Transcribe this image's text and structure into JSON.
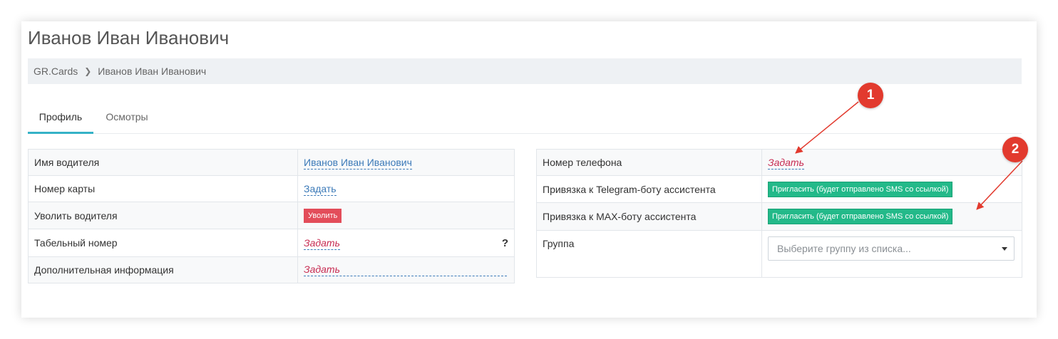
{
  "header": {
    "title": "Иванов Иван Иванович"
  },
  "breadcrumb": {
    "root": "GR.Cards",
    "current": "Иванов Иван Иванович"
  },
  "tabs": [
    {
      "label": "Профиль",
      "active": true
    },
    {
      "label": "Осмотры",
      "active": false
    }
  ],
  "left_table": {
    "driver_name": {
      "label": "Имя водителя",
      "value": "Иванов Иван Иванович"
    },
    "card_number": {
      "label": "Номер карты",
      "value": "Задать"
    },
    "dismiss": {
      "label": "Уволить водителя",
      "button": "Уволить"
    },
    "personnel_number": {
      "label": "Табельный номер",
      "value": "Задать",
      "help": "?"
    },
    "additional_info": {
      "label": "Дополнительная информация",
      "value": "Задать"
    }
  },
  "right_table": {
    "phone": {
      "label": "Номер телефона",
      "value": "Задать"
    },
    "telegram": {
      "label": "Привязка к Telegram-боту ассистента",
      "button": "Пригласить (будет отправлено SMS со ссылкой)"
    },
    "max": {
      "label": "Привязка к MAX-боту ассистента",
      "button": "Пригласить (будет отправлено SMS со ссылкой)"
    },
    "group": {
      "label": "Группа",
      "placeholder": "Выберите группу из списка..."
    }
  },
  "annotations": {
    "marker_1": "1",
    "marker_2": "2"
  },
  "colors": {
    "accent_tab": "#35b2c7",
    "link": "#3c7ab8",
    "empty_value": "#c72b51",
    "danger": "#e34d5a",
    "success": "#23b989",
    "annotation": "#e23a2e"
  }
}
